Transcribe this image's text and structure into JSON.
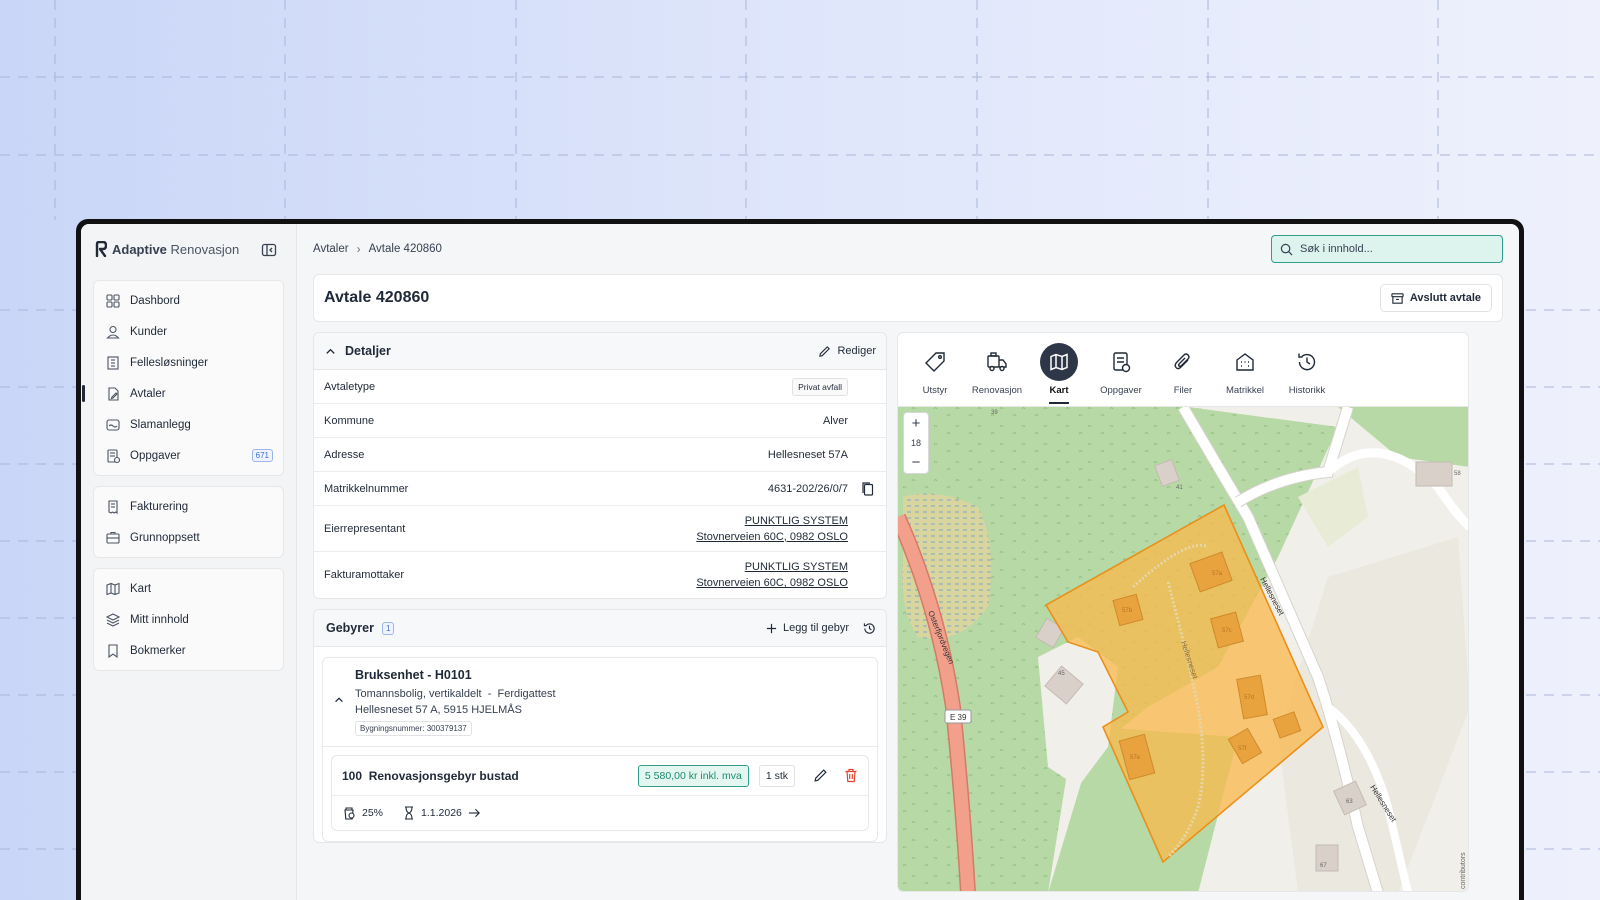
{
  "brand": {
    "name_bold": "Adaptive",
    "name_light": "Renovasjon"
  },
  "sidebar": {
    "groups": [
      [
        {
          "label": "Dashbord",
          "icon": "dashboard-icon"
        },
        {
          "label": "Kunder",
          "icon": "user-icon"
        },
        {
          "label": "Fellesløsninger",
          "icon": "building-icon"
        },
        {
          "label": "Avtaler",
          "icon": "contract-icon",
          "active": true
        },
        {
          "label": "Slamanlegg",
          "icon": "sludge-icon"
        },
        {
          "label": "Oppgaver",
          "icon": "task-icon",
          "badge": "671"
        }
      ],
      [
        {
          "label": "Fakturering",
          "icon": "invoice-icon"
        },
        {
          "label": "Grunnoppsett",
          "icon": "setup-icon"
        }
      ],
      [
        {
          "label": "Kart",
          "icon": "map-icon"
        },
        {
          "label": "Mitt innhold",
          "icon": "layers-icon"
        },
        {
          "label": "Bokmerker",
          "icon": "bookmark-icon"
        }
      ]
    ]
  },
  "breadcrumb": {
    "parent": "Avtaler",
    "current": "Avtale 420860"
  },
  "search": {
    "placeholder": "Søk i innhold..."
  },
  "page": {
    "title": "Avtale 420860",
    "end_button": "Avslutt avtale"
  },
  "details": {
    "title": "Detaljer",
    "edit_label": "Rediger",
    "rows": {
      "avtaletype": {
        "label": "Avtaletype",
        "value": "Privat avfall"
      },
      "kommune": {
        "label": "Kommune",
        "value": "Alver"
      },
      "adresse": {
        "label": "Adresse",
        "value": "Hellesneset 57A"
      },
      "matrikkel": {
        "label": "Matrikkelnummer",
        "value": "4631-202/26/0/7"
      },
      "eier": {
        "label": "Eierrepresentant",
        "name": "PUNKTLIG SYSTEM",
        "address": "Stovnerveien 60C, 0982 OSLO"
      },
      "faktura": {
        "label": "Fakturamottaker",
        "name": "PUNKTLIG SYSTEM",
        "address": "Stovnerveien 60C, 0982 OSLO"
      }
    }
  },
  "fees": {
    "title": "Gebyrer",
    "count": "1",
    "add_label": "Legg til gebyr",
    "unit": {
      "title": "Bruksenhet - H0101",
      "type": "Tomannsbolig, vertikaldelt",
      "status": "Ferdigattest",
      "address": "Hellesneset 57 A, 5915 HJELMÅS",
      "building_number": "Bygningsnummer: 300379137"
    },
    "item": {
      "code": "100",
      "name": "Renovasjonsgebyr bustad",
      "price": "5 580,00 kr inkl. mva",
      "quantity": "1 stk",
      "share": "25%",
      "date": "1.1.2026"
    }
  },
  "tabs": [
    {
      "label": "Utstyr",
      "icon": "tag-icon"
    },
    {
      "label": "Renovasjon",
      "icon": "truck-icon"
    },
    {
      "label": "Kart",
      "icon": "map-icon",
      "active": true
    },
    {
      "label": "Oppgaver",
      "icon": "task-icon"
    },
    {
      "label": "Filer",
      "icon": "paperclip-icon"
    },
    {
      "label": "Matrikkel",
      "icon": "building-icon"
    },
    {
      "label": "Historikk",
      "icon": "history-icon"
    }
  ],
  "map": {
    "zoom_level": "18",
    "road_labels": {
      "hellesneset_a": "Hellesneset",
      "hellesneset_b": "Hellesneset",
      "hellesneset_c": "Hellesneset",
      "osterfjord": "Osterfjordvegen",
      "e39": "E 39"
    },
    "house_numbers": {
      "n39": "39",
      "n41": "41",
      "n45": "45",
      "n58": "58",
      "n63": "63",
      "n67": "67",
      "n57a": "57a",
      "n57b": "57b",
      "n57c": "57c",
      "n57d": "57d",
      "n57e": "57e",
      "n57f": "57f"
    },
    "attribution": "contributors",
    "colors": {
      "forest": "#b6d9a5",
      "land": "#f1efe9",
      "road": "#ffffff",
      "motorway": "#f2a08c",
      "parcel": "#f9b84b"
    }
  }
}
